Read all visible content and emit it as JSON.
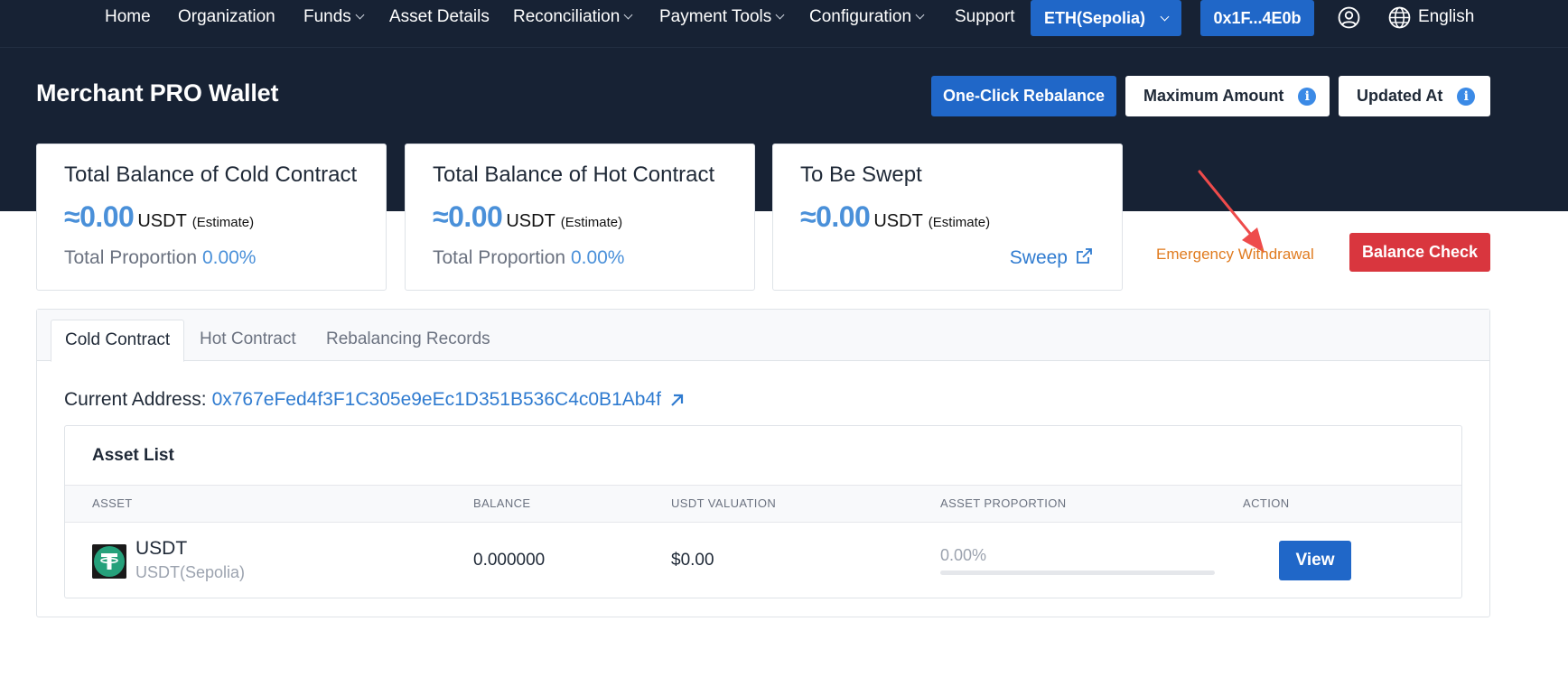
{
  "nav": {
    "items": [
      {
        "label": "Home",
        "dropdown": false
      },
      {
        "label": "Organization",
        "dropdown": false
      },
      {
        "label": "Funds",
        "dropdown": true
      },
      {
        "label": "Asset Details",
        "dropdown": false
      },
      {
        "label": "Reconciliation",
        "dropdown": true
      },
      {
        "label": "Payment Tools",
        "dropdown": true
      },
      {
        "label": "Configuration",
        "dropdown": true
      },
      {
        "label": "Support",
        "dropdown": false
      }
    ],
    "network": "ETH(Sepolia)",
    "account": "0x1F...4E0b",
    "language": "English"
  },
  "header": {
    "title": "Merchant PRO Wallet",
    "rebalance_label": "One-Click Rebalance",
    "max_amount_label": "Maximum Amount",
    "updated_at_label": "Updated At",
    "info_glyph": "i"
  },
  "cards": [
    {
      "title": "Total Balance of Cold Contract",
      "amount": "≈0.00",
      "unit": "USDT",
      "estimate": "(Estimate)",
      "proportion_label": "Total Proportion",
      "proportion": "0.00%"
    },
    {
      "title": "Total Balance of Hot Contract",
      "amount": "≈0.00",
      "unit": "USDT",
      "estimate": "(Estimate)",
      "proportion_label": "Total Proportion",
      "proportion": "0.00%"
    },
    {
      "title": "To Be Swept",
      "amount": "≈0.00",
      "unit": "USDT",
      "estimate": "(Estimate)",
      "sweep_label": "Sweep"
    }
  ],
  "actions": {
    "emergency_label": "Emergency Withdrawal",
    "balance_check_label": "Balance Check"
  },
  "tabs": [
    {
      "label": "Cold Contract",
      "active": true
    },
    {
      "label": "Hot Contract",
      "active": false
    },
    {
      "label": "Rebalancing Records",
      "active": false
    }
  ],
  "current_address": {
    "label": "Current Address:",
    "value": "0x767eFed4f3F1C305e9eEc1D351B536C4c0B1Ab4f"
  },
  "asset_list": {
    "title": "Asset List",
    "columns": [
      "ASSET",
      "BALANCE",
      "USDT VALUATION",
      "ASSET PROPORTION",
      "ACTION"
    ],
    "rows": [
      {
        "asset": "USDT",
        "network": "USDT(Sepolia)",
        "balance": "0.000000",
        "valuation": "$0.00",
        "proportion_text": "0.00%",
        "proportion_value": 0,
        "action": "View"
      }
    ]
  },
  "colors": {
    "dark_bg": "#172234",
    "primary_blue": "#2067c8",
    "danger_red": "#d9363e",
    "emergency_orange": "#e07b1f",
    "tether_green": "#26a17b"
  }
}
